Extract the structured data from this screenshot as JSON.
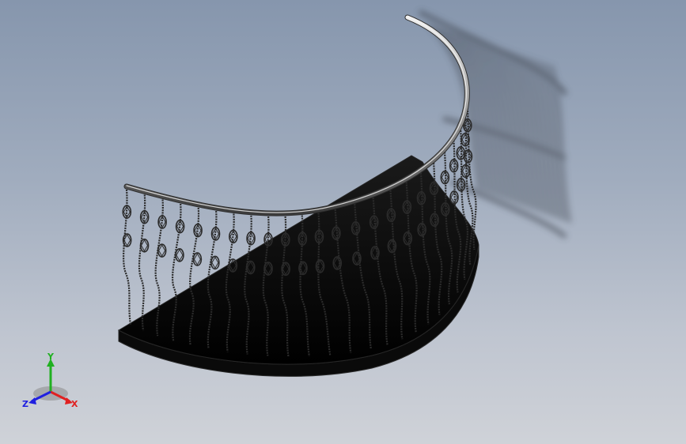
{
  "viewport": {
    "background_top": "#8696ad",
    "background_bottom": "#cfd2d8"
  },
  "model": {
    "railing_color": "#b9b9b9",
    "baluster_color": "#2b2b2b",
    "base_color": "#050505",
    "shadow_color": "#3a3f48"
  },
  "triad": {
    "x_label": "X",
    "y_label": "Y",
    "z_label": "Z",
    "x_color": "#e02020",
    "y_color": "#20b020",
    "z_color": "#2020e0",
    "icon": "view-orientation-triad-icon"
  }
}
